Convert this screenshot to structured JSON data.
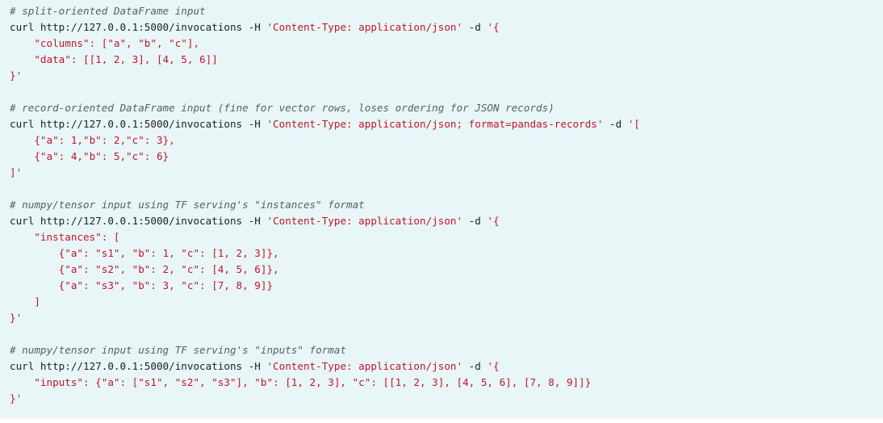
{
  "code": {
    "language": "shell",
    "colors": {
      "background": "#e8f6f7",
      "comment": "#5e5e5e",
      "string": "#c2152a",
      "plain": "#222222"
    },
    "lines": [
      [
        {
          "t": "comment",
          "v": "# split-oriented DataFrame input"
        }
      ],
      [
        {
          "t": "plain",
          "v": "curl http://127.0.0.1:5000/invocations -H "
        },
        {
          "t": "str",
          "v": "'Content-Type: application/json'"
        },
        {
          "t": "plain",
          "v": " -d "
        },
        {
          "t": "str",
          "v": "'{"
        }
      ],
      [
        {
          "t": "str",
          "v": "    \"columns\": [\"a\", \"b\", \"c\"],"
        }
      ],
      [
        {
          "t": "str",
          "v": "    \"data\": [[1, 2, 3], [4, 5, 6]]"
        }
      ],
      [
        {
          "t": "str",
          "v": "}'"
        }
      ],
      [],
      [
        {
          "t": "comment",
          "v": "# record-oriented DataFrame input (fine for vector rows, loses ordering for JSON records)"
        }
      ],
      [
        {
          "t": "plain",
          "v": "curl http://127.0.0.1:5000/invocations -H "
        },
        {
          "t": "str",
          "v": "'Content-Type: application/json; format=pandas-records'"
        },
        {
          "t": "plain",
          "v": " -d "
        },
        {
          "t": "str",
          "v": "'["
        }
      ],
      [
        {
          "t": "str",
          "v": "    {\"a\": 1,\"b\": 2,\"c\": 3},"
        }
      ],
      [
        {
          "t": "str",
          "v": "    {\"a\": 4,\"b\": 5,\"c\": 6}"
        }
      ],
      [
        {
          "t": "str",
          "v": "]'"
        }
      ],
      [],
      [
        {
          "t": "comment",
          "v": "# numpy/tensor input using TF serving's \"instances\" format"
        }
      ],
      [
        {
          "t": "plain",
          "v": "curl http://127.0.0.1:5000/invocations -H "
        },
        {
          "t": "str",
          "v": "'Content-Type: application/json'"
        },
        {
          "t": "plain",
          "v": " -d "
        },
        {
          "t": "str",
          "v": "'{"
        }
      ],
      [
        {
          "t": "str",
          "v": "    \"instances\": ["
        }
      ],
      [
        {
          "t": "str",
          "v": "        {\"a\": \"s1\", \"b\": 1, \"c\": [1, 2, 3]},"
        }
      ],
      [
        {
          "t": "str",
          "v": "        {\"a\": \"s2\", \"b\": 2, \"c\": [4, 5, 6]},"
        }
      ],
      [
        {
          "t": "str",
          "v": "        {\"a\": \"s3\", \"b\": 3, \"c\": [7, 8, 9]}"
        }
      ],
      [
        {
          "t": "str",
          "v": "    ]"
        }
      ],
      [
        {
          "t": "str",
          "v": "}'"
        }
      ],
      [],
      [
        {
          "t": "comment",
          "v": "# numpy/tensor input using TF serving's \"inputs\" format"
        }
      ],
      [
        {
          "t": "plain",
          "v": "curl http://127.0.0.1:5000/invocations -H "
        },
        {
          "t": "str",
          "v": "'Content-Type: application/json'"
        },
        {
          "t": "plain",
          "v": " -d "
        },
        {
          "t": "str",
          "v": "'{"
        }
      ],
      [
        {
          "t": "str",
          "v": "    \"inputs\": {\"a\": [\"s1\", \"s2\", \"s3\"], \"b\": [1, 2, 3], \"c\": [[1, 2, 3], [4, 5, 6], [7, 8, 9]]}"
        }
      ],
      [
        {
          "t": "str",
          "v": "}'"
        }
      ]
    ]
  }
}
